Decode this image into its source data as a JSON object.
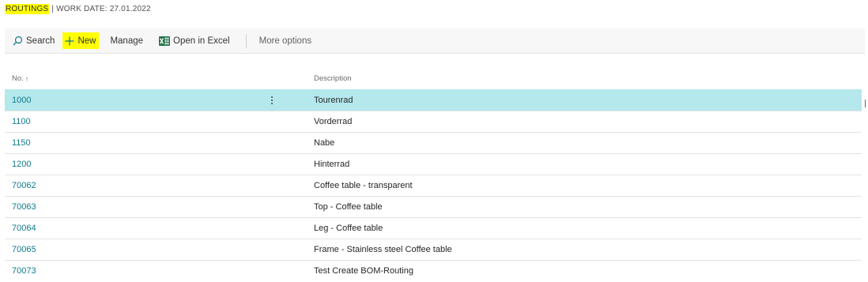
{
  "header": {
    "title_highlight": "ROUTINGS",
    "title_rest": "| WORK DATE: 27.01.2022"
  },
  "actions": {
    "search_label": "Search",
    "new_label": "New",
    "manage_label": "Manage",
    "excel_label": "Open in Excel",
    "more_label": "More options"
  },
  "table": {
    "columns": {
      "no": "No.",
      "no_sort": "↑",
      "description": "Description"
    },
    "rows": [
      {
        "no": "1000",
        "description": "Tourenrad",
        "selected": true
      },
      {
        "no": "1100",
        "description": "Vorderrad",
        "selected": false
      },
      {
        "no": "1150",
        "description": "Nabe",
        "selected": false
      },
      {
        "no": "1200",
        "description": "Hinterrad",
        "selected": false
      },
      {
        "no": "70062",
        "description": "Coffee table - transparent",
        "selected": false
      },
      {
        "no": "70063",
        "description": "Top - Coffee table",
        "selected": false
      },
      {
        "no": "70064",
        "description": "Leg - Coffee table",
        "selected": false
      },
      {
        "no": "70065",
        "description": "Frame - Stainless steel Coffee table",
        "selected": false
      },
      {
        "no": "70073",
        "description": "Test Create BOM-Routing",
        "selected": false
      }
    ]
  },
  "colors": {
    "highlight": "#ffff00",
    "selected_row": "#b4e8ec",
    "link": "#117a8b",
    "excel_green": "#1e7145"
  },
  "icons": {
    "search": "search-icon",
    "new": "plus-icon",
    "excel": "excel-icon",
    "row_menu": "kebab-menu-icon"
  }
}
